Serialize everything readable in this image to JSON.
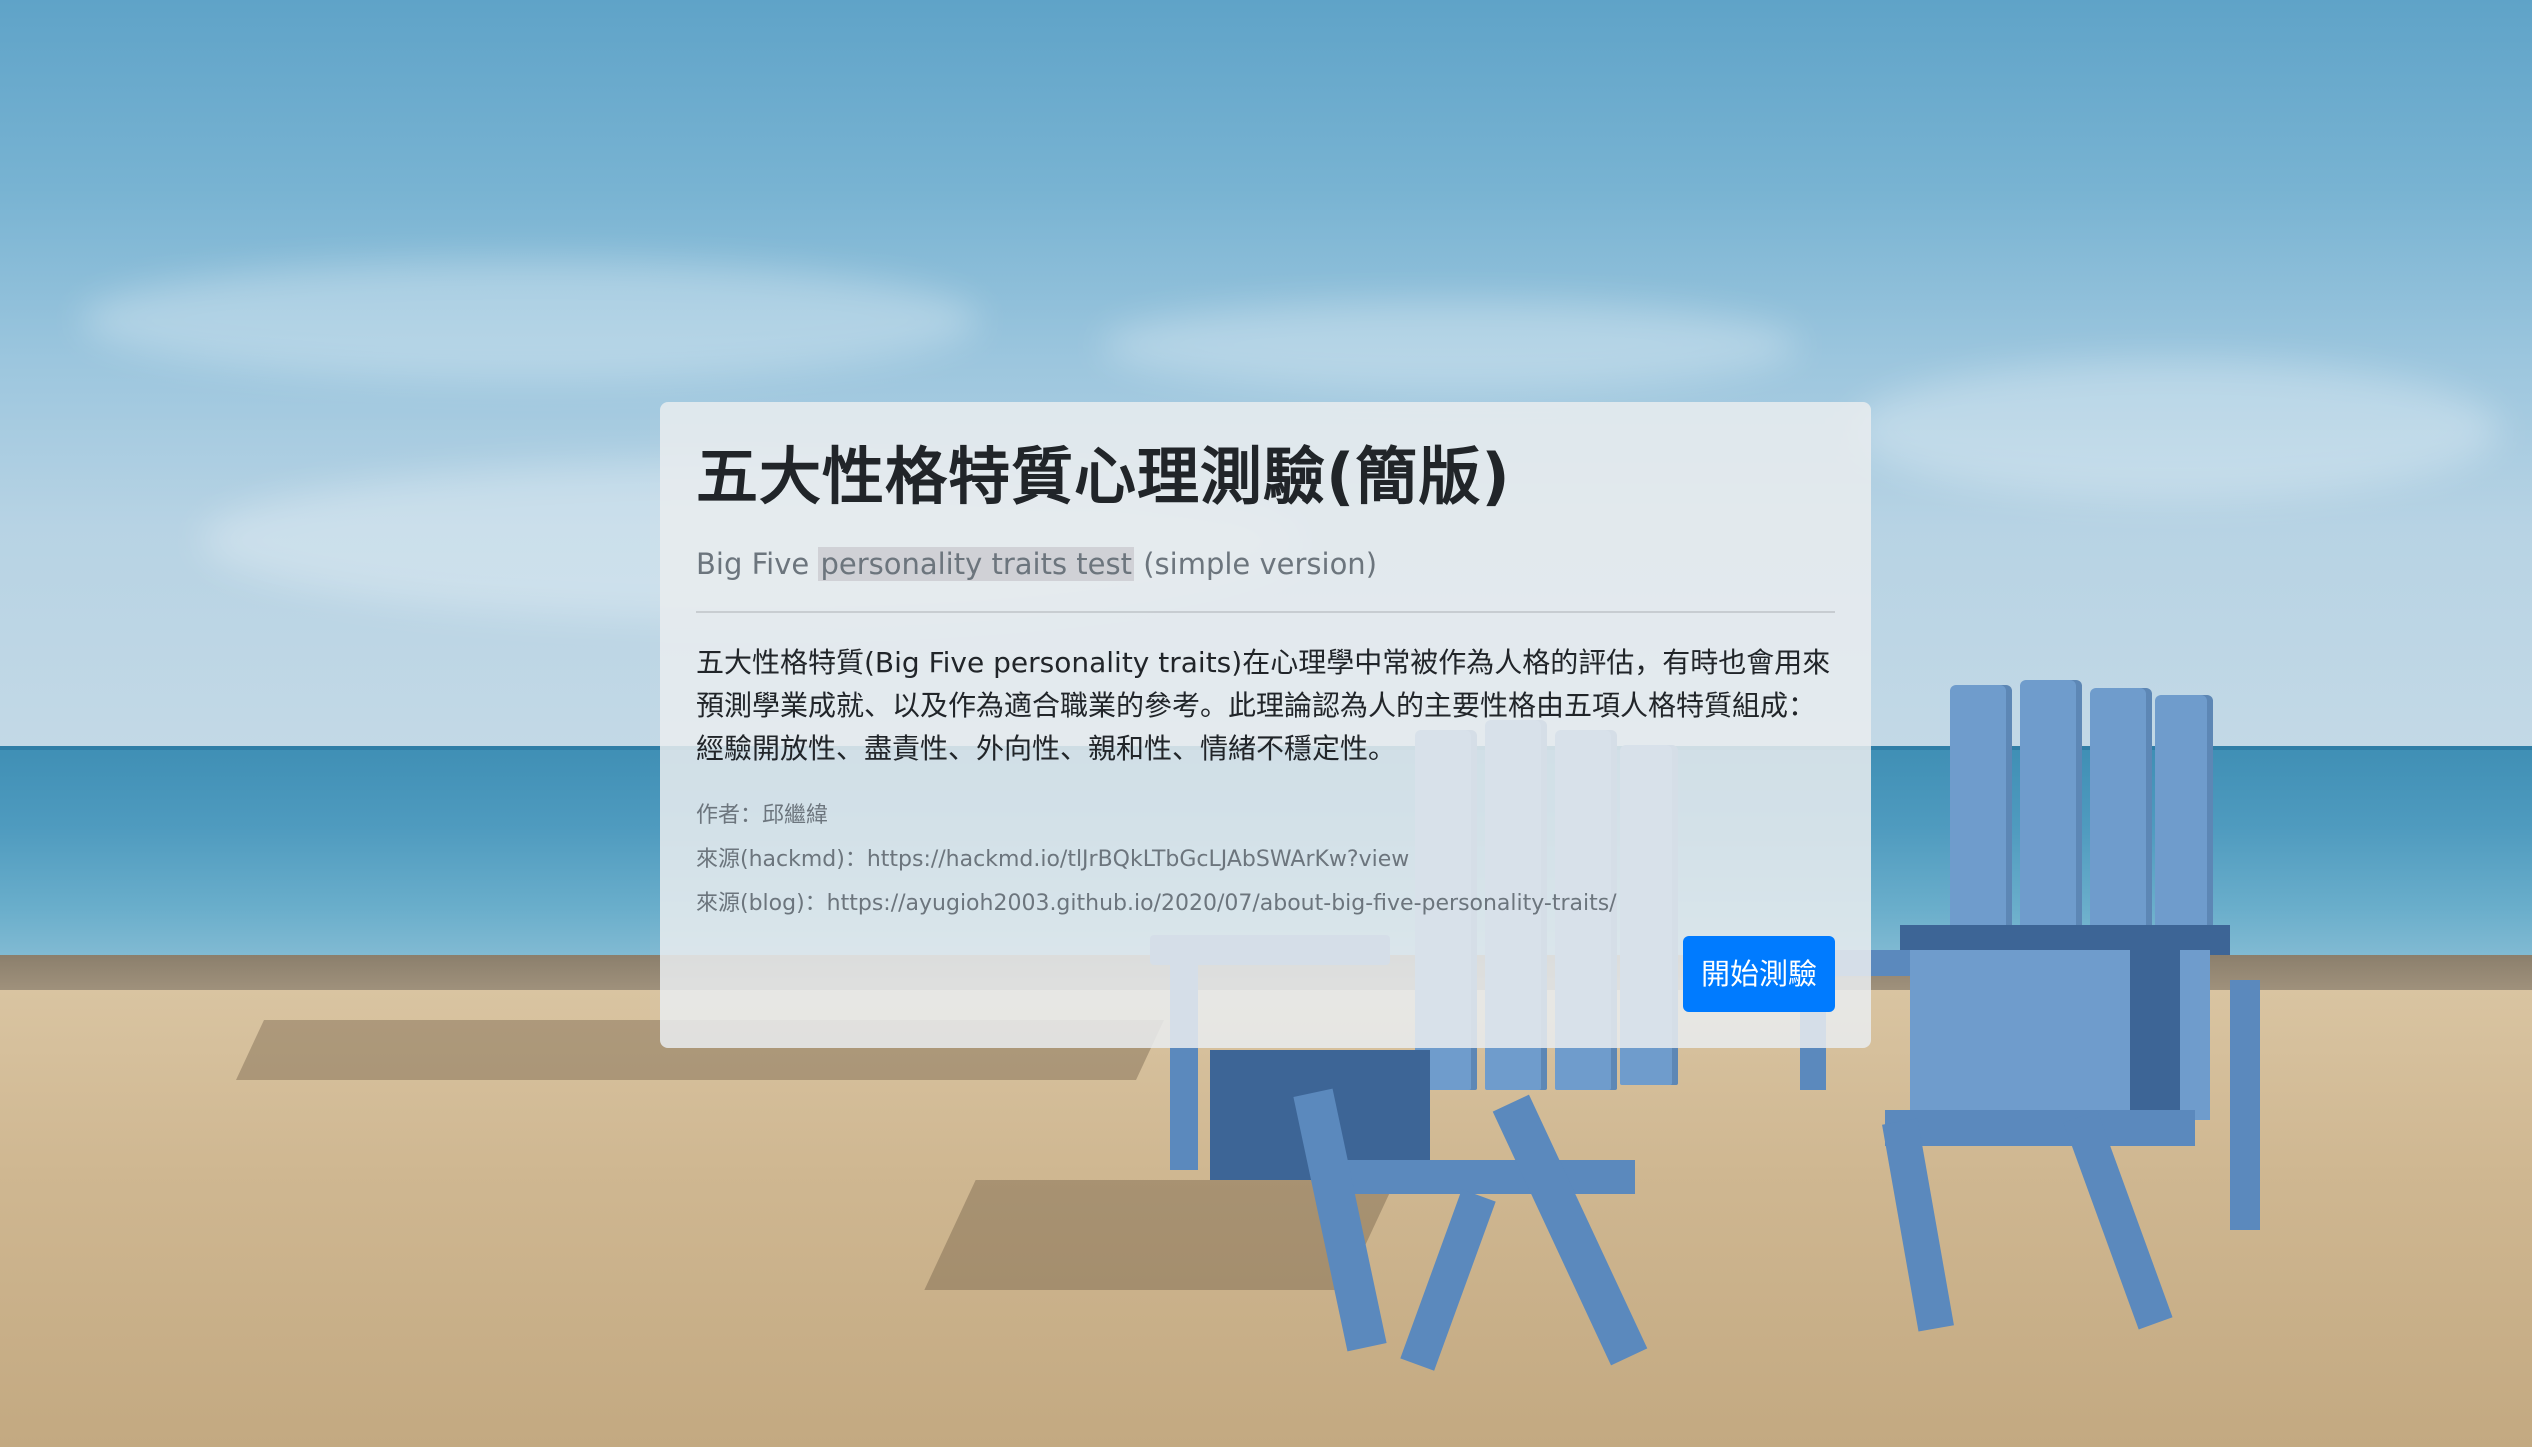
{
  "card": {
    "title": "五大性格特質心理測驗(簡版)",
    "subtitle_before": "Big Five ",
    "subtitle_highlight": "personality traits test",
    "subtitle_after": " (simple version)",
    "description": "五大性格特質(Big Five personality traits)在心理學中常被作為人格的評估，有時也會用來預測學業成就、以及作為適合職業的參考。此理論認為人的主要性格由五項人格特質組成：經驗開放性、盡責性、外向性、親和性、情緒不穩定性。",
    "author_label": "作者：",
    "author_name": "邱繼緯",
    "source_hackmd_label": "來源(hackmd)：",
    "source_hackmd_url": "https://hackmd.io/tlJrBQkLTbGcLJAbSWArKw?view",
    "source_blog_label": "來源(blog)：",
    "source_blog_url": "https://ayugioh2003.github.io/2020/07/about-big-five-personality-traits/",
    "start_button_label": "開始測驗"
  },
  "colors": {
    "button": "#007bff",
    "card_background": "#e9ecef"
  }
}
